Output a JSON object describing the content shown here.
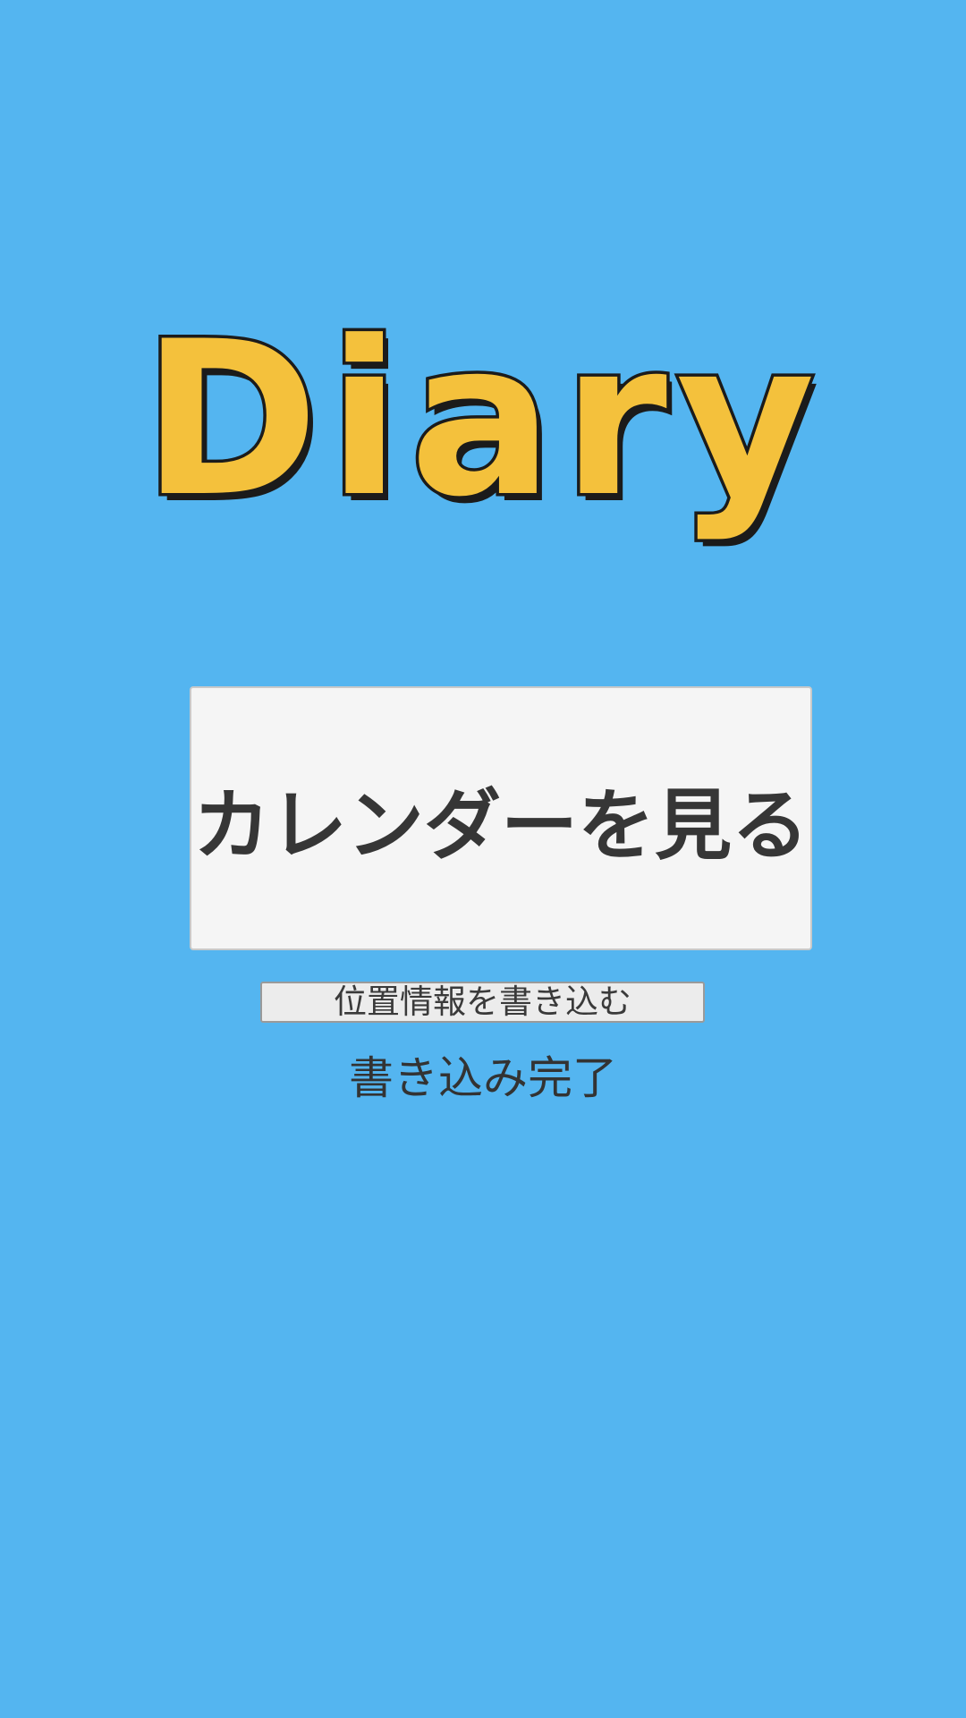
{
  "app": {
    "title": "Diary"
  },
  "main": {
    "calendar_button_label": "カレンダーを見る",
    "location_button_label": "位置情報を書き込む",
    "status_text": "書き込み完了"
  },
  "colors": {
    "background": "#54b5f0",
    "logo_fill": "#f4c13c",
    "logo_outline": "#1b1b1b",
    "button_background": "#f5f5f5",
    "text": "#363636"
  }
}
